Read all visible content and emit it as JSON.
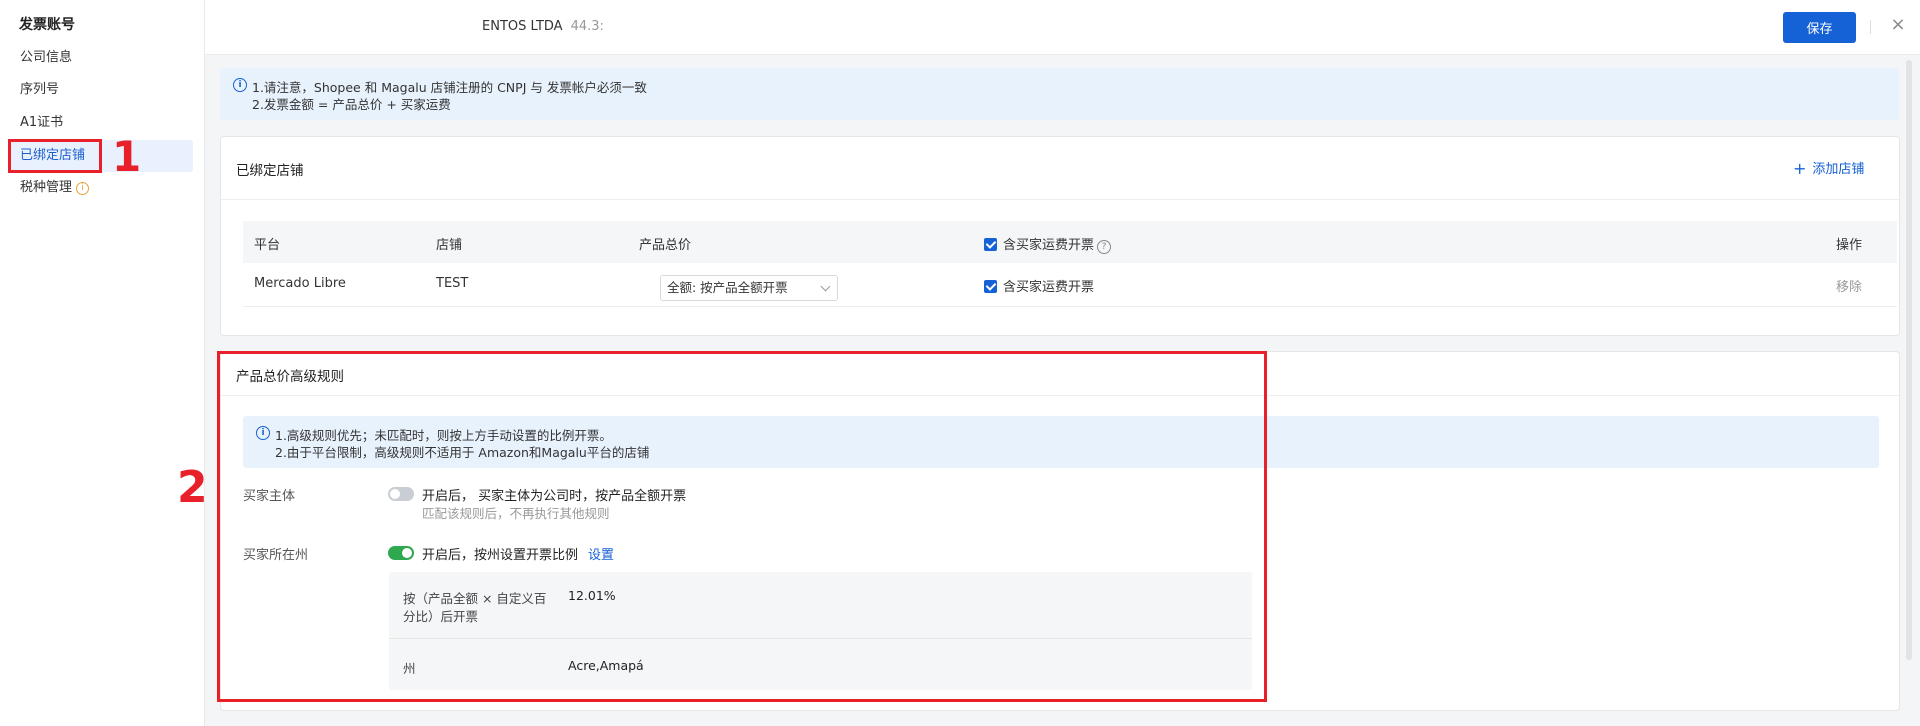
{
  "sidebar": {
    "title": "发票账号",
    "items": [
      {
        "label": "公司信息"
      },
      {
        "label": "序列号"
      },
      {
        "label": "A1证书"
      },
      {
        "label": "已绑定店铺",
        "active": true
      },
      {
        "label": "税种管理",
        "info_icon": "i"
      }
    ]
  },
  "annotations": {
    "one": "1",
    "two": "2"
  },
  "header": {
    "company_name": "ENTOS LTDA",
    "company_cnpj": "44.3:",
    "save_label": "保存",
    "close_icon": "×"
  },
  "notice": {
    "icon": "i",
    "line1": "1.请注意，Shopee 和 Magalu 店铺注册的 CNPJ 与 发票帐户必须一致",
    "line2": "2.发票金额 = 产品总价 + 买家运费"
  },
  "bound_stores": {
    "title": "已绑定店铺",
    "add_label": "添加店铺",
    "columns": {
      "platform": "平台",
      "store": "店铺",
      "total": "产品总价",
      "shipping": "含买家运费开票",
      "action": "操作"
    },
    "rows": [
      {
        "platform": "Mercado Libre",
        "store": "TEST",
        "total_select": "全额: 按产品全额开票",
        "shipping": "含买家运费开票",
        "action": "移除"
      }
    ]
  },
  "advanced": {
    "title": "产品总价高级规则",
    "notice_line1": "1.高级规则优先；未匹配时，则按上方手动设置的比例开票。",
    "notice_line2": "2.由于平台限制，高级规则不适用于 Amazon和Magalu平台的店铺",
    "buyer_entity": {
      "label": "买家主体",
      "enabled": false,
      "text": "开启后， 买家主体为公司时，按产品全额开票",
      "sub": "匹配该规则后，不再执行其他规则"
    },
    "buyer_state": {
      "label": "买家所在州",
      "enabled": true,
      "text": "开启后，按州设置开票比例",
      "link": "设置",
      "detail_label1": "按（产品全额 × 自定义百",
      "detail_label2": "分比）后开票",
      "detail_value": "12.01%",
      "state_label": "州",
      "state_value": "Acre,Amapá"
    }
  }
}
